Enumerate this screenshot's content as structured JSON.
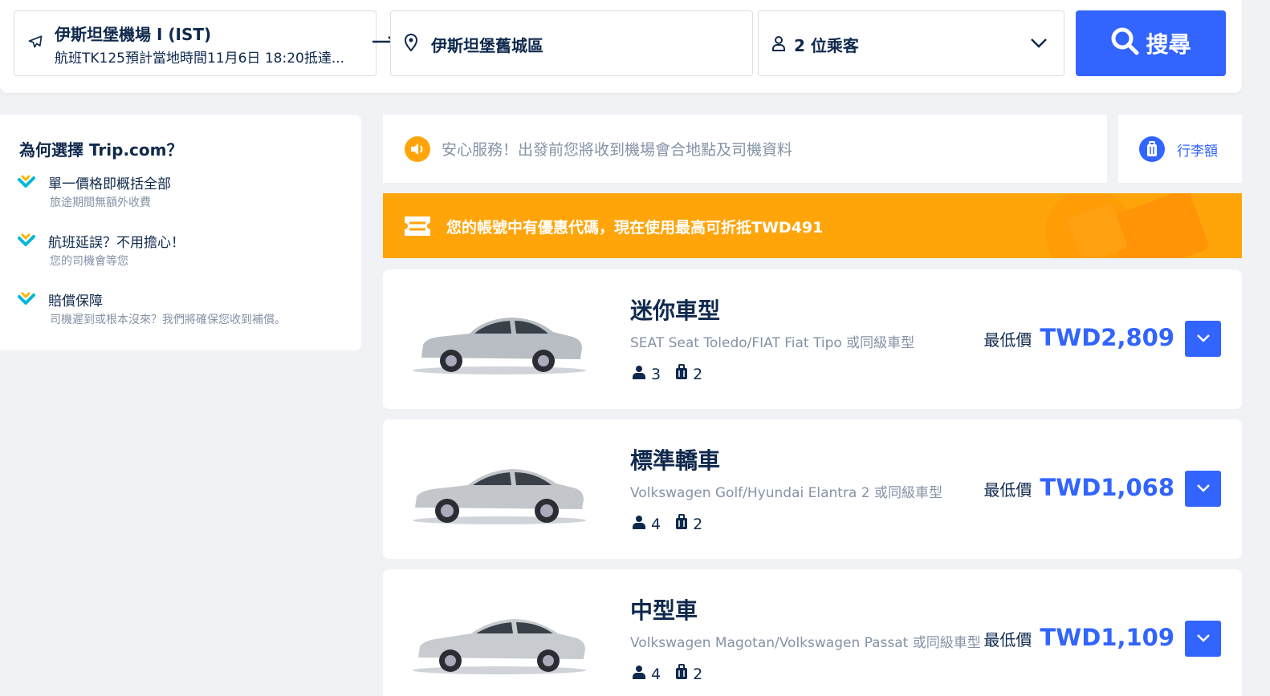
{
  "search": {
    "from_title": "伊斯坦堡機場 I (IST)",
    "from_subtitle": "航班TK125預計當地時間11月6日 18:20抵達...",
    "to_title": "伊斯坦堡舊城區",
    "passengers": "2 位乘客",
    "search_label": "搜尋"
  },
  "why": {
    "title": "為何選擇 Trip.com？",
    "items": [
      {
        "title": "單一價格即概括全部",
        "sub": "旅途期間無額外收費"
      },
      {
        "title": "航班延誤？不用擔心！",
        "sub": "您的司機會等您"
      },
      {
        "title": "賠償保障",
        "sub": "司機遲到或根本沒來？我們將確保您收到補償。"
      }
    ]
  },
  "notice": {
    "text": "安心服務！出發前您將收到機場會合地點及司機資料",
    "luggage_label": "行李額"
  },
  "promo": {
    "text": "您的帳號中有優惠代碼，現在使用最高可折抵TWD491"
  },
  "cars": [
    {
      "name": "迷你車型",
      "models": "SEAT Seat Toledo/FIAT Fiat Tipo 或同級車型",
      "pax": "3",
      "bags": "2",
      "price_label": "最低價",
      "price": "TWD2,809"
    },
    {
      "name": "標準轎車",
      "models": "Volkswagen Golf/Hyundai Elantra 2 或同級車型",
      "pax": "4",
      "bags": "2",
      "price_label": "最低價",
      "price": "TWD1,068"
    },
    {
      "name": "中型車",
      "models": "Volkswagen Magotan/Volkswagen Passat 或同級車型",
      "pax": "4",
      "bags": "2",
      "price_label": "最低價",
      "price": "TWD1,109"
    }
  ],
  "colors": {
    "primary": "#3264ff",
    "promo": "#ffa50a",
    "text": "#0f294d",
    "muted": "#8592a6",
    "check": "#00b8d9",
    "check_accent": "#ffb400"
  }
}
